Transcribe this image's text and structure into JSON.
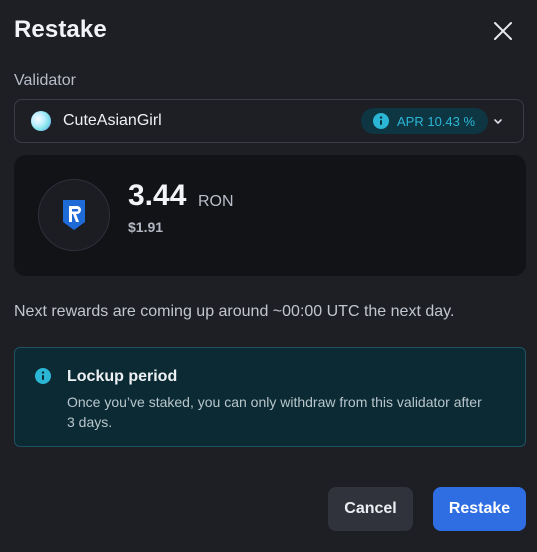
{
  "dialog": {
    "title": "Restake",
    "close_icon": "close-icon"
  },
  "validator": {
    "label": "Validator",
    "selected_name": "CuteAsianGirl",
    "apr_text": "APR 10.43 %",
    "apr_icon": "info-icon",
    "dropdown_icon": "chevron-down-icon"
  },
  "amount": {
    "value": "3.44",
    "unit": "RON",
    "usd_value": "$1.91",
    "token_icon": "ronin-token-icon"
  },
  "rewards_note": "Next rewards are coming up around ~00:00 UTC the next day.",
  "notice": {
    "icon": "info-icon",
    "title": "Lockup period",
    "body": "Once you’ve staked, you can only withdraw from this validator after 3 days."
  },
  "actions": {
    "cancel_label": "Cancel",
    "restake_label": "Restake"
  },
  "colors": {
    "background": "#1d1f25",
    "primary_button": "#2f6ee2",
    "info_accent": "#2bb6d6",
    "ronin_blue": "#1e6bd8"
  }
}
